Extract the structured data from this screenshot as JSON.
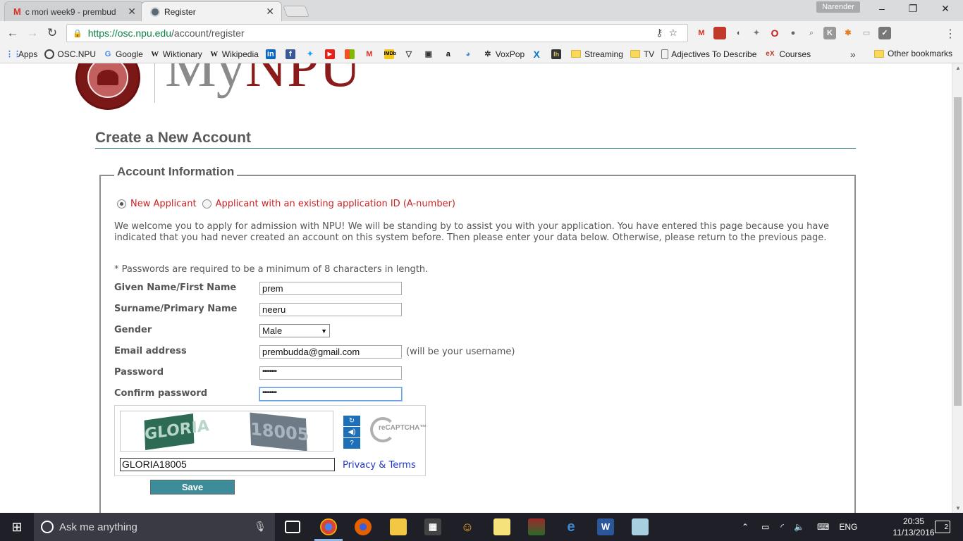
{
  "browser": {
    "tabs": [
      {
        "title": "c mori week9 - prembud",
        "icon": "gmail-icon",
        "active": false
      },
      {
        "title": "Register",
        "icon": "globe-icon",
        "active": true
      }
    ],
    "profile_name": "Narender",
    "url": {
      "secure": "https://osc.npu.edu",
      "path": "/account/register"
    },
    "bookmarks": [
      {
        "label": "Apps",
        "icon": "apps-grid-icon"
      },
      {
        "label": "OSC.NPU",
        "icon": "osc-icon"
      },
      {
        "label": "Google",
        "icon": "google-icon"
      },
      {
        "label": "Wiktionary",
        "icon": "wiktionary-icon"
      },
      {
        "label": "Wikipedia",
        "icon": "wikipedia-icon"
      },
      {
        "label": "VoxPop",
        "icon": "voxpop-icon"
      },
      {
        "label": "Streaming",
        "icon": "folder-icon"
      },
      {
        "label": "TV",
        "icon": "folder-icon"
      },
      {
        "label": "Adjectives To Describe",
        "icon": "page-icon"
      },
      {
        "label": "Courses",
        "icon": "edx-icon"
      }
    ],
    "other_bookmarks": "Other bookmarks"
  },
  "logo": {
    "my": "My",
    "npu": "NPU"
  },
  "page": {
    "heading": "Create a New Account",
    "section_legend": "Account Information",
    "radio_new": "New Applicant",
    "radio_existing": "Applicant with an existing application ID (A-number)",
    "welcome_text": "We welcome you to apply for admission with NPU! We will be standing by to assist you with your application. You have entered this page because you have indicated that you had never created an account on this system before. Then please enter your data below. Otherwise, please return to the previous page.",
    "password_note": "* Passwords are required to be a minimum of 8 characters in length."
  },
  "form": {
    "first_name": {
      "label": "Given Name/First Name",
      "value": "prem"
    },
    "surname": {
      "label": "Surname/Primary Name",
      "value": "neeru"
    },
    "gender": {
      "label": "Gender",
      "value": "Male"
    },
    "email": {
      "label": "Email address",
      "value": "prembudda@gmail.com",
      "hint": "(will be your username)"
    },
    "password": {
      "label": "Password",
      "value": "••••••••"
    },
    "confirm_password": {
      "label": "Confirm password",
      "value": "••••••••"
    }
  },
  "captcha": {
    "word1": "GLORIA",
    "word2": "18005",
    "response": "GLORIA18005",
    "brand": "reCAPTCHA™",
    "privacy_link": "Privacy & Terms"
  },
  "save_label": "Save",
  "taskbar": {
    "search_placeholder": "Ask me anything",
    "language": "ENG",
    "time": "20:35",
    "date": "11/13/2016",
    "notifications": "2"
  },
  "colors": {
    "accent_teal": "#3c8d99",
    "brand_red": "#8b1a1a",
    "radio_label_red": "#cc2222"
  }
}
